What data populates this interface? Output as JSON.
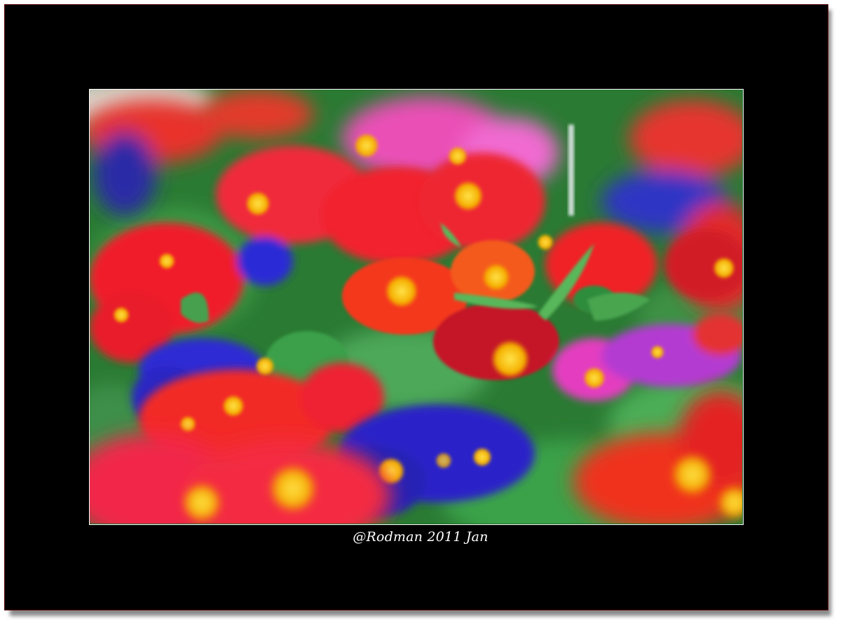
{
  "photo": {
    "subject": "flower-bed",
    "caption": "@Rodman 2011 Jan"
  },
  "colors": {
    "mat": "#000000",
    "photo_border": "#ffffff",
    "mat_edge": "#5a0000",
    "caption_text": "#ffffff"
  }
}
